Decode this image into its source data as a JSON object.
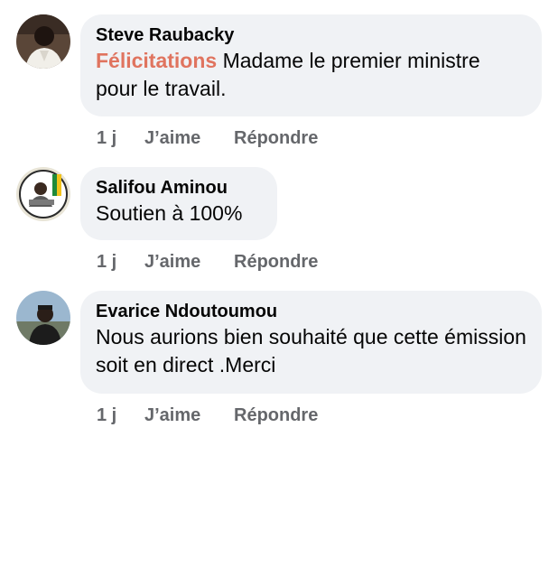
{
  "comments": [
    {
      "author": "Steve Raubacky",
      "highlight": "Félicitations",
      "text": " Madame le premier ministre pour le travail.",
      "time": "1 j",
      "like_label": "J’aime",
      "reply_label": "Répondre"
    },
    {
      "author": "Salifou Aminou",
      "highlight": "",
      "text": "Soutien à 100%",
      "time": "1 j",
      "like_label": "J’aime",
      "reply_label": "Répondre"
    },
    {
      "author": "Evarice Ndoutoumou",
      "highlight": "",
      "text": "Nous aurions bien souhaité  que cette émission soit en direct .Merci",
      "time": "1 j",
      "like_label": "J’aime",
      "reply_label": "Répondre"
    }
  ],
  "colors": {
    "bubble": "#f0f2f5",
    "highlight": "#e0745f",
    "meta": "#65676b"
  }
}
